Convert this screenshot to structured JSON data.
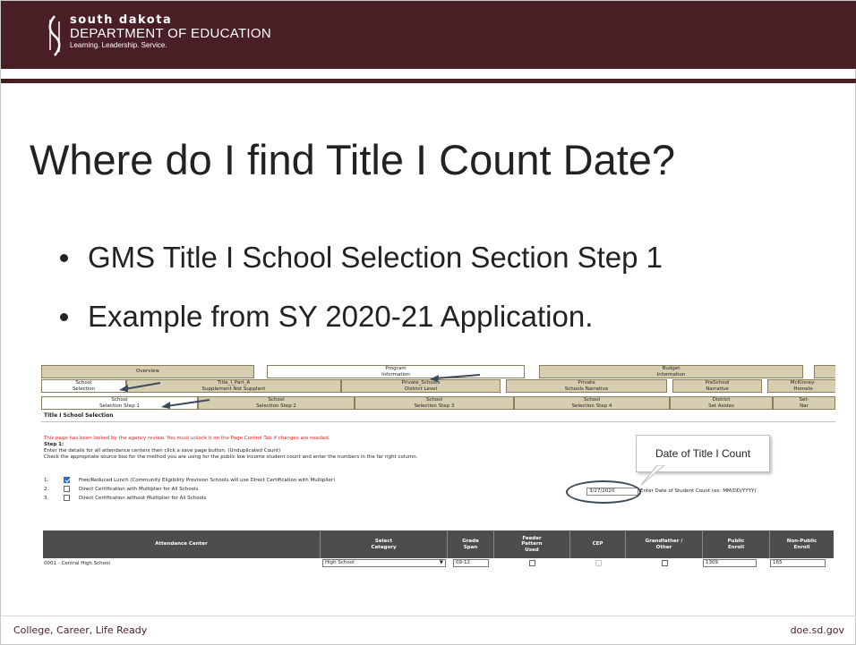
{
  "logo": {
    "line1": "south dakota",
    "line2": "DEPARTMENT OF EDUCATION",
    "line3": "Learning. Leadership. Service."
  },
  "slide": {
    "title": "Where do I find Title I Count Date?",
    "bullets": [
      "GMS Title I School Selection Section Step 1",
      "Example from SY 2020-21 Application."
    ]
  },
  "screenshot": {
    "tabs_row1": [
      "Overview",
      "Program\nInformation",
      "Budget\nInformation"
    ],
    "tabs_row2": [
      "School\nSelection",
      "Title_I_Part_A\nSupplement Not Supplant",
      "Private_Schools\nDistrict Level",
      "Private\nSchools Narrative",
      "PreSchool\nNarrative",
      "McKinney-\nHomele"
    ],
    "tabs_row3": [
      "School\nSelection Step 1",
      "School\nSelection Step 2",
      "School\nSelection Step 3",
      "School\nSelection Step 4",
      "District\nSet Asides",
      "Set-\nNar"
    ],
    "section_title": "Title I School Selection",
    "locked_notice": "This page has been locked by the agency review. You must unlock it on the Page Control Tab if changes are needed.",
    "step_label": "Step 1:",
    "instruction1": "Enter the details for all attendance centers then click a save page button. (Unduplicated Count)",
    "instruction2": "Check the appropriate source box for the method you are using for the public low income student count and enter the numbers in the far right column.",
    "options": [
      {
        "num": "1.",
        "label": "Free/Reduced Lunch (Community Eligibility Provision Schools will use Direct Certification with Multiplier)",
        "checked": true
      },
      {
        "num": "2.",
        "label": "Direct Certification with Multiplier for All Schools",
        "checked": false
      },
      {
        "num": "3.",
        "label": "Direct Certification without Multiplier for All Schools",
        "checked": false
      }
    ],
    "count_date": "3/27/2020",
    "count_date_hint": "Enter Date of Student Count (ex: MM/DD/YYYY)",
    "callout": "Date of Title I Count",
    "grid_headers": [
      "Attendance Center",
      "Select\nCategory",
      "Grade\nSpan",
      "Feeder\nPattern\nUsed",
      "CEP",
      "Grandfather /\nOther",
      "Public\nEnroll",
      "Non-Public\nEnroll"
    ],
    "grid_row": {
      "center": "0001 - Central High School",
      "category": "High School",
      "grade_span": "09-12",
      "public_enroll": "1309",
      "nonpublic_enroll": "165"
    }
  },
  "footer": {
    "left": "College, Career, Life Ready",
    "right": "doe.sd.gov"
  },
  "colors": {
    "brand": "#4a1e25",
    "tab": "#d7ceb2",
    "grid_header": "#4d4d4d",
    "locked": "#dd2222"
  }
}
